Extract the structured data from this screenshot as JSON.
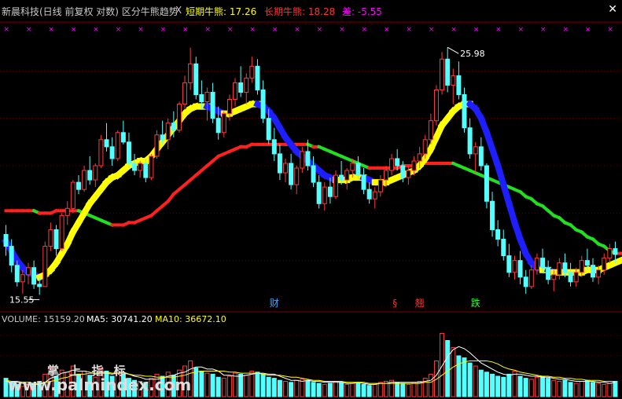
{
  "header": {
    "title": "新晨科技(日线 前复权 对数) 区分牛熊趋势",
    "close_glyph": "X",
    "short_label": "短期牛熊: 17.26",
    "long_label": "长期牛熊: 18.28",
    "diff_label": "差: -5.55",
    "colors": {
      "title": "#c8c8c8",
      "short": "#ffff00",
      "long": "#ff3333",
      "diff": "#ff00ff"
    }
  },
  "annotations": {
    "high_label": "25.98",
    "low_label": "15.55",
    "markers": [
      {
        "text": "财",
        "color": "#4aa8ff"
      },
      {
        "text": "§",
        "color": "#ff3333"
      },
      {
        "text": "翘",
        "color": "#ff3333"
      },
      {
        "text": "跌",
        "color": "#33ff33"
      }
    ]
  },
  "volume_header": {
    "volume": "VOLUME: 15159.20",
    "ma5": "MA5: 30741.20",
    "ma10": "MA10: 36672.10",
    "colors": {
      "volume": "#c8c8c8",
      "ma5": "#ffffff",
      "ma10": "#ffff00"
    }
  },
  "watermark": {
    "line1": "掌 上 指 标",
    "line2": "www.palmindex.com"
  },
  "chart_data": {
    "type": "candlestick",
    "price_range": [
      15.0,
      27.0
    ],
    "grid": true,
    "candles": [
      [
        18.1,
        18.5,
        17.2,
        17.6
      ],
      [
        17.6,
        17.9,
        16.5,
        16.8
      ],
      [
        16.8,
        17.0,
        15.9,
        16.1
      ],
      [
        16.1,
        16.6,
        15.6,
        16.4
      ],
      [
        16.4,
        16.9,
        16.0,
        16.7
      ],
      [
        16.7,
        17.0,
        15.8,
        16.0
      ],
      [
        16.0,
        16.3,
        15.55,
        15.9
      ],
      [
        15.9,
        17.8,
        15.9,
        17.6
      ],
      [
        17.6,
        18.6,
        17.4,
        18.3
      ],
      [
        18.3,
        18.5,
        17.2,
        17.5
      ],
      [
        17.5,
        19.0,
        17.4,
        18.9
      ],
      [
        18.9,
        19.5,
        18.5,
        19.2
      ],
      [
        19.2,
        20.4,
        19.0,
        20.3
      ],
      [
        20.3,
        20.6,
        19.8,
        20.0
      ],
      [
        20.0,
        21.0,
        19.9,
        20.8
      ],
      [
        20.8,
        21.4,
        20.2,
        20.4
      ],
      [
        20.4,
        21.1,
        20.1,
        21.0
      ],
      [
        21.0,
        22.3,
        20.9,
        22.1
      ],
      [
        22.1,
        22.8,
        21.6,
        21.8
      ],
      [
        21.8,
        22.2,
        21.0,
        21.3
      ],
      [
        21.3,
        22.5,
        21.2,
        22.4
      ],
      [
        22.4,
        22.9,
        21.9,
        22.0
      ],
      [
        22.0,
        22.4,
        20.9,
        21.1
      ],
      [
        21.1,
        21.5,
        20.6,
        20.8
      ],
      [
        20.8,
        21.2,
        20.5,
        21.1
      ],
      [
        21.1,
        21.3,
        20.3,
        20.5
      ],
      [
        20.5,
        21.5,
        20.4,
        21.4
      ],
      [
        21.4,
        22.5,
        21.3,
        22.3
      ],
      [
        22.3,
        22.9,
        21.9,
        22.1
      ],
      [
        22.1,
        23.0,
        21.7,
        22.8
      ],
      [
        22.8,
        23.3,
        22.2,
        22.5
      ],
      [
        22.5,
        23.7,
        22.4,
        23.6
      ],
      [
        23.6,
        24.8,
        23.4,
        24.5
      ],
      [
        24.5,
        25.98,
        24.2,
        25.3
      ],
      [
        25.3,
        25.6,
        23.8,
        24.0
      ],
      [
        24.0,
        24.6,
        23.4,
        23.7
      ],
      [
        23.7,
        24.3,
        22.9,
        24.1
      ],
      [
        24.1,
        24.5,
        22.8,
        23.0
      ],
      [
        23.0,
        23.5,
        22.1,
        22.4
      ],
      [
        22.4,
        23.3,
        22.2,
        23.2
      ],
      [
        23.2,
        24.0,
        22.9,
        23.8
      ],
      [
        23.8,
        24.7,
        23.5,
        24.5
      ],
      [
        24.5,
        25.2,
        23.9,
        24.1
      ],
      [
        24.1,
        24.9,
        23.6,
        24.7
      ],
      [
        24.7,
        25.6,
        24.5,
        25.2
      ],
      [
        25.2,
        25.5,
        24.0,
        24.2
      ],
      [
        24.2,
        24.6,
        22.8,
        23.0
      ],
      [
        23.0,
        23.4,
        21.9,
        22.1
      ],
      [
        22.1,
        22.6,
        21.2,
        21.5
      ],
      [
        21.5,
        21.9,
        20.4,
        20.7
      ],
      [
        20.7,
        21.3,
        20.3,
        21.1
      ],
      [
        21.1,
        21.5,
        20.0,
        20.2
      ],
      [
        20.2,
        21.0,
        19.8,
        20.9
      ],
      [
        20.9,
        21.8,
        20.7,
        21.6
      ],
      [
        21.6,
        22.1,
        20.8,
        21.0
      ],
      [
        21.0,
        21.4,
        20.1,
        20.3
      ],
      [
        20.3,
        20.6,
        19.2,
        19.4
      ],
      [
        19.4,
        20.3,
        19.1,
        20.1
      ],
      [
        20.1,
        20.5,
        19.4,
        19.7
      ],
      [
        19.7,
        20.8,
        19.6,
        20.6
      ],
      [
        20.6,
        21.2,
        20.2,
        20.4
      ],
      [
        20.4,
        20.9,
        20.0,
        20.8
      ],
      [
        20.8,
        21.3,
        20.5,
        21.1
      ],
      [
        21.1,
        21.4,
        20.4,
        20.6
      ],
      [
        20.6,
        20.9,
        19.8,
        20.0
      ],
      [
        20.0,
        20.3,
        19.4,
        19.6
      ],
      [
        19.6,
        20.1,
        19.2,
        19.9
      ],
      [
        19.9,
        20.6,
        19.7,
        20.4
      ],
      [
        20.4,
        21.0,
        20.1,
        20.8
      ],
      [
        20.8,
        21.5,
        20.6,
        21.3
      ],
      [
        21.3,
        21.7,
        20.8,
        21.0
      ],
      [
        21.0,
        21.2,
        20.3,
        20.5
      ],
      [
        20.5,
        21.0,
        20.2,
        20.8
      ],
      [
        20.8,
        21.4,
        20.6,
        21.2
      ],
      [
        21.2,
        21.8,
        20.9,
        21.5
      ],
      [
        21.5,
        22.3,
        21.3,
        22.1
      ],
      [
        22.1,
        23.2,
        21.9,
        22.9
      ],
      [
        22.9,
        24.4,
        22.7,
        24.2
      ],
      [
        24.2,
        25.8,
        24.0,
        25.5
      ],
      [
        25.5,
        26.0,
        24.1,
        24.4
      ],
      [
        24.4,
        25.1,
        23.6,
        24.8
      ],
      [
        24.8,
        25.4,
        23.8,
        24.0
      ],
      [
        24.0,
        24.3,
        22.4,
        22.6
      ],
      [
        22.6,
        23.0,
        21.3,
        21.5
      ],
      [
        21.5,
        22.0,
        20.7,
        21.8
      ],
      [
        21.8,
        22.2,
        20.8,
        21.0
      ],
      [
        21.0,
        21.1,
        19.2,
        19.5
      ],
      [
        19.5,
        19.9,
        18.0,
        18.3
      ],
      [
        18.3,
        18.7,
        17.6,
        17.9
      ],
      [
        17.9,
        18.3,
        17.0,
        17.2
      ],
      [
        17.2,
        17.7,
        16.3,
        16.5
      ],
      [
        16.5,
        17.2,
        16.2,
        17.0
      ],
      [
        17.0,
        17.4,
        16.0,
        16.3
      ],
      [
        16.3,
        16.6,
        15.6,
        15.9
      ],
      [
        15.9,
        16.8,
        15.8,
        16.6
      ],
      [
        16.6,
        17.3,
        16.4,
        17.1
      ],
      [
        17.1,
        17.5,
        16.5,
        16.7
      ],
      [
        16.7,
        17.0,
        16.0,
        16.2
      ],
      [
        16.2,
        16.6,
        15.7,
        16.4
      ],
      [
        16.4,
        17.1,
        16.2,
        16.9
      ],
      [
        16.9,
        17.3,
        16.3,
        16.5
      ],
      [
        16.5,
        16.9,
        15.9,
        16.1
      ],
      [
        16.1,
        16.7,
        15.9,
        16.5
      ],
      [
        16.5,
        17.2,
        16.3,
        17.0
      ],
      [
        17.0,
        17.5,
        16.6,
        16.8
      ],
      [
        16.8,
        17.1,
        16.1,
        16.3
      ],
      [
        16.3,
        16.8,
        16.0,
        16.6
      ],
      [
        16.6,
        17.3,
        16.4,
        17.1
      ],
      [
        17.1,
        17.7,
        16.9,
        17.5
      ],
      [
        17.5,
        17.8,
        16.9,
        17.26
      ]
    ],
    "short_term_line": [
      17.8,
      17.4,
      17.0,
      16.7,
      16.5,
      16.4,
      16.3,
      16.4,
      16.6,
      16.9,
      17.3,
      17.7,
      18.2,
      18.6,
      19.0,
      19.4,
      19.7,
      20.0,
      20.3,
      20.5,
      20.6,
      20.8,
      21.0,
      21.1,
      21.2,
      21.2,
      21.4,
      21.7,
      22.0,
      22.3,
      22.6,
      22.9,
      23.2,
      23.4,
      23.5,
      23.5,
      23.5,
      23.4,
      23.3,
      23.2,
      23.2,
      23.3,
      23.4,
      23.5,
      23.6,
      23.6,
      23.5,
      23.3,
      23.0,
      22.6,
      22.2,
      21.9,
      21.6,
      21.4,
      21.2,
      21.0,
      20.8,
      20.6,
      20.5,
      20.4,
      20.4,
      20.4,
      20.5,
      20.5,
      20.5,
      20.4,
      20.3,
      20.3,
      20.3,
      20.4,
      20.5,
      20.6,
      20.7,
      20.8,
      21.0,
      21.3,
      21.7,
      22.2,
      22.7,
      23.0,
      23.3,
      23.5,
      23.6,
      23.6,
      23.4,
      23.0,
      22.4,
      21.7,
      21.0,
      20.2,
      19.4,
      18.6,
      17.9,
      17.3,
      16.9,
      16.7,
      16.6,
      16.6,
      16.5,
      16.5,
      16.5,
      16.5,
      16.5,
      16.5,
      16.6,
      16.6,
      16.6,
      16.7,
      16.8,
      16.9,
      17.0,
      17.1
    ],
    "long_term_line": [
      19.1,
      19.1,
      19.1,
      19.1,
      19.1,
      19.1,
      19.0,
      19.0,
      19.0,
      19.1,
      19.1,
      19.1,
      19.1,
      19.1,
      19.0,
      18.9,
      18.8,
      18.7,
      18.6,
      18.5,
      18.5,
      18.5,
      18.6,
      18.6,
      18.7,
      18.8,
      18.9,
      19.1,
      19.3,
      19.5,
      19.8,
      20.0,
      20.2,
      20.4,
      20.6,
      20.8,
      21.0,
      21.2,
      21.4,
      21.5,
      21.6,
      21.7,
      21.8,
      21.8,
      21.9,
      21.9,
      21.9,
      21.9,
      21.9,
      21.9,
      21.9,
      21.9,
      21.9,
      21.9,
      21.9,
      21.8,
      21.8,
      21.7,
      21.6,
      21.5,
      21.4,
      21.3,
      21.2,
      21.1,
      21.0,
      20.9,
      20.9,
      20.9,
      20.9,
      20.9,
      20.9,
      21.0,
      21.0,
      21.0,
      21.1,
      21.1,
      21.1,
      21.1,
      21.1,
      21.1,
      21.1,
      21.0,
      20.9,
      20.8,
      20.7,
      20.6,
      20.5,
      20.4,
      20.3,
      20.2,
      20.1,
      20.0,
      19.9,
      19.7,
      19.6,
      19.4,
      19.3,
      19.1,
      18.9,
      18.8,
      18.6,
      18.5,
      18.3,
      18.2,
      18.0,
      17.9,
      17.7,
      17.6,
      17.4,
      17.3,
      17.3,
      17.3
    ],
    "volume": [
      18,
      14,
      12,
      10,
      11,
      13,
      15,
      22,
      28,
      20,
      26,
      24,
      30,
      22,
      25,
      21,
      19,
      28,
      25,
      20,
      24,
      22,
      18,
      16,
      15,
      14,
      18,
      22,
      20,
      24,
      21,
      26,
      30,
      35,
      28,
      25,
      23,
      22,
      19,
      18,
      20,
      23,
      22,
      21,
      25,
      24,
      22,
      19,
      18,
      16,
      15,
      14,
      16,
      17,
      16,
      14,
      13,
      12,
      13,
      15,
      14,
      12,
      13,
      14,
      12,
      11,
      12,
      14,
      15,
      16,
      14,
      13,
      12,
      14,
      15,
      18,
      22,
      35,
      62,
      55,
      48,
      40,
      38,
      33,
      30,
      26,
      24,
      22,
      20,
      19,
      22,
      25,
      20,
      18,
      17,
      19,
      20,
      18,
      16,
      15,
      16,
      14,
      13,
      15,
      16,
      14,
      13,
      12,
      13,
      15
    ],
    "volume_ma5": [
      15,
      14,
      14,
      13,
      12,
      12,
      12,
      14,
      18,
      20,
      23,
      24,
      26,
      25,
      25,
      24,
      22,
      23,
      23,
      22,
      23,
      24,
      22,
      20,
      19,
      17,
      17,
      17,
      18,
      20,
      21,
      23,
      24,
      27,
      29,
      29,
      27,
      27,
      25,
      21,
      21,
      20,
      20,
      21,
      22,
      23,
      23,
      22,
      22,
      20,
      18,
      16,
      16,
      15,
      16,
      15,
      15,
      14,
      14,
      14,
      14,
      13,
      13,
      14,
      13,
      12,
      12,
      13,
      13,
      14,
      14,
      14,
      14,
      14,
      14,
      15,
      16,
      21,
      30,
      39,
      46,
      49,
      47,
      43,
      38,
      33,
      30,
      27,
      24,
      22,
      21,
      22,
      22,
      21,
      20,
      20,
      19,
      19,
      18,
      17,
      17,
      16,
      15,
      15,
      15,
      15,
      14,
      14,
      13,
      14
    ],
    "volume_ma10": [
      16,
      15,
      15,
      14,
      14,
      13,
      13,
      14,
      15,
      16,
      18,
      19,
      21,
      22,
      22,
      23,
      23,
      24,
      24,
      23,
      23,
      23,
      22,
      21,
      21,
      20,
      20,
      19,
      19,
      19,
      19,
      20,
      21,
      23,
      24,
      25,
      25,
      25,
      25,
      25,
      24,
      24,
      23,
      23,
      23,
      23,
      22,
      21,
      21,
      21,
      20,
      19,
      19,
      18,
      17,
      16,
      16,
      15,
      15,
      15,
      15,
      14,
      14,
      14,
      14,
      13,
      13,
      13,
      13,
      13,
      13,
      13,
      13,
      13,
      13,
      14,
      14,
      17,
      21,
      25,
      29,
      32,
      34,
      35,
      35,
      35,
      35,
      34,
      32,
      29,
      27,
      26,
      24,
      23,
      22,
      21,
      20,
      20,
      19,
      19,
      18,
      18,
      17,
      17,
      16,
      16,
      16,
      15,
      15,
      15
    ],
    "volume_range": [
      0,
      70
    ]
  }
}
